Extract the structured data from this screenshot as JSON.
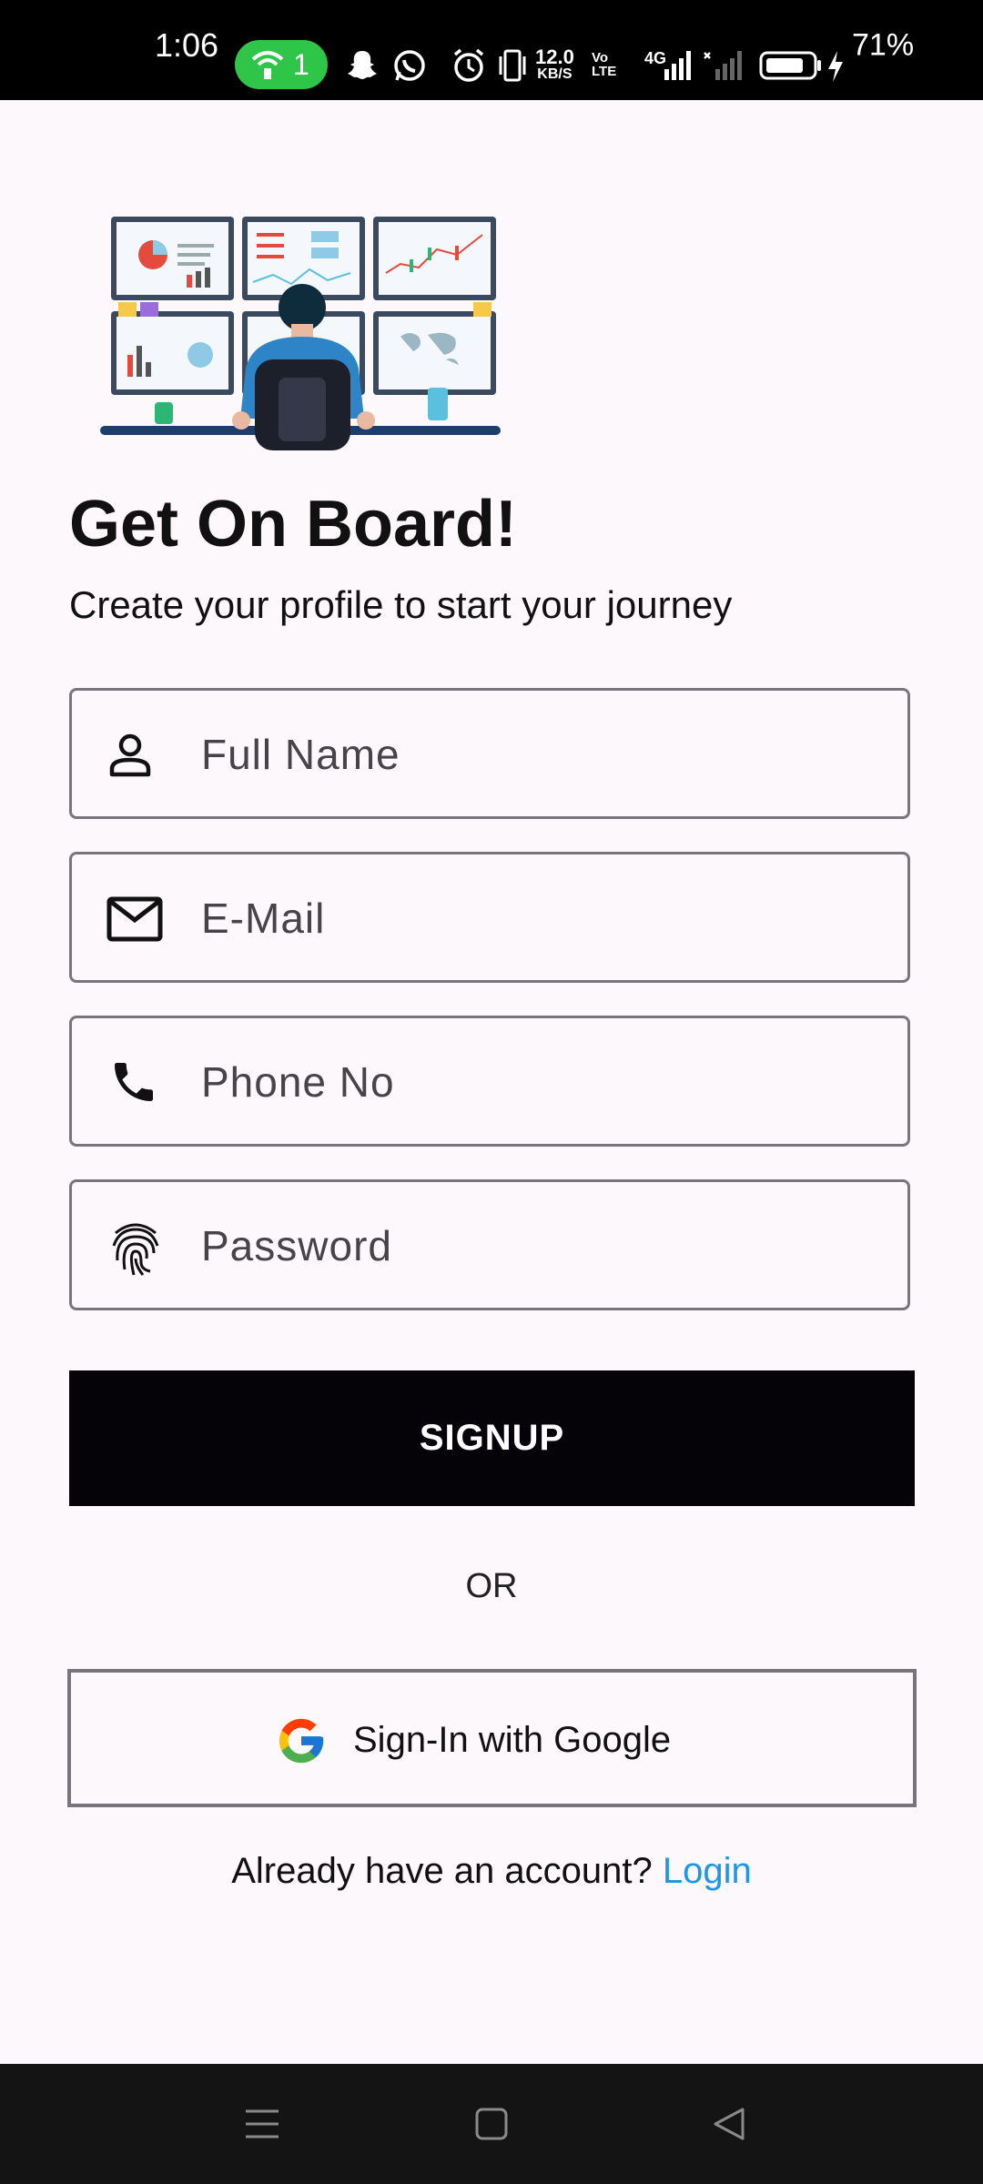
{
  "status_bar": {
    "time": "1:06",
    "hotspot_count": "1",
    "net_speed_value": "12.0",
    "net_speed_unit": "KB/S",
    "volte": "Vo LTE",
    "network": "4G",
    "battery": "71%"
  },
  "header": {
    "title": "Get On Board!",
    "subtitle": "Create your profile to start your journey"
  },
  "form": {
    "full_name": {
      "placeholder": "Full Name",
      "icon": "person-icon"
    },
    "email": {
      "placeholder": "E-Mail",
      "icon": "mail-icon"
    },
    "phone": {
      "placeholder": "Phone No",
      "icon": "phone-icon"
    },
    "password": {
      "placeholder": "Password",
      "icon": "fingerprint-icon"
    }
  },
  "actions": {
    "signup_label": "SIGNUP",
    "or_label": "OR",
    "google_label": "Sign-In with Google",
    "login_prompt": "Already have an account?",
    "login_link": "Login"
  },
  "colors": {
    "background": "#fdf8fb",
    "primary_button": "#050208",
    "link": "#2196e5",
    "hotspot": "#2fc548"
  }
}
